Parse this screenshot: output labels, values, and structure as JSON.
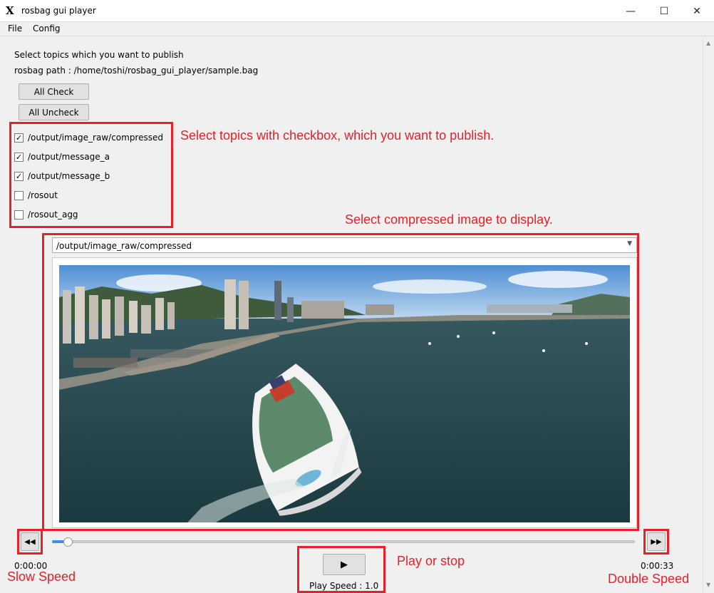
{
  "window": {
    "title": "rosbag gui player",
    "app_icon_glyph": "X",
    "minimize_glyph": "—",
    "maximize_glyph": "☐",
    "close_glyph": "✕"
  },
  "menu": {
    "items": [
      {
        "label": "File"
      },
      {
        "label": "Config"
      }
    ]
  },
  "main": {
    "instruction": "Select topics which you want to publish",
    "rosbag_path": "rosbag path : /home/toshi/rosbag_gui_player/sample.bag",
    "all_check_label": "All Check",
    "all_uncheck_label": "All Uncheck",
    "topics": [
      {
        "name": "/output/image_raw/compressed",
        "checked": true,
        "mark": "✓"
      },
      {
        "name": "/output/message_a",
        "checked": true,
        "mark": "✓"
      },
      {
        "name": "/output/message_b",
        "checked": true,
        "mark": "✓"
      },
      {
        "name": "/rosout",
        "checked": false,
        "mark": ""
      },
      {
        "name": "/rosout_agg",
        "checked": false,
        "mark": ""
      }
    ],
    "image_topic_selected": "/output/image_raw/compressed",
    "combo_arrow": "▼",
    "rewind_glyph": "◀◀",
    "forward_glyph": "▶▶",
    "play_glyph": "▶",
    "time_current": "0:00:00",
    "time_total": "0:00:33",
    "progress_fraction": 0.02,
    "play_speed": "Play Speed : 1.0"
  },
  "annotations": {
    "topics": "Select topics with checkbox, which you want to publish.",
    "image": "Select compressed image to display.",
    "play": "Play or stop",
    "slow": "Slow Speed",
    "double": "Double Speed"
  },
  "colors": {
    "annotation_red": "#e8202a",
    "slider_blue": "#3d8ee6"
  }
}
